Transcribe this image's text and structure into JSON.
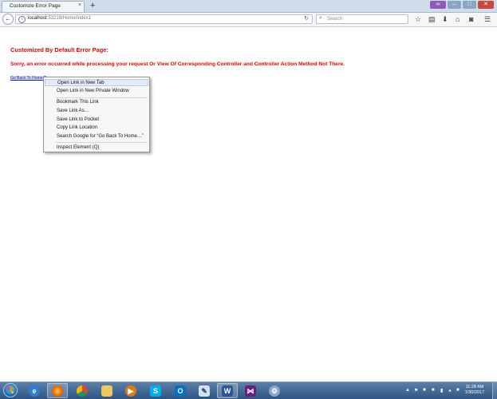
{
  "browser": {
    "tab_title": "Customize Error Page",
    "tab_close": "×",
    "new_tab": "+",
    "url_host": "localhost",
    "url_rest": ":53218/Home/index1",
    "search_placeholder": "Search"
  },
  "page": {
    "title": "Customized By Default Error Page:",
    "message": "Sorry, an error occurred while processing your request Or View Of Corresponding Controller and Controller Action Method Not There.",
    "home_link": "Go Back To Home P"
  },
  "context_menu": {
    "items": [
      "Open Link in New Tab",
      "Open Link in New Private Window",
      "Bookmark This Link",
      "Save Link As…",
      "Save Link to Pocket",
      "Copy Link Location",
      "Search Google for “Go Back To Home…”",
      "Inspect Element (Q)"
    ]
  },
  "taskbar": {
    "apps": [
      "internet-explorer-icon",
      "firefox-icon",
      "chrome-icon",
      "file-explorer-icon",
      "media-player-icon",
      "skype-icon",
      "outlook-icon",
      "paint-icon",
      "word-icon",
      "visual-studio-icon",
      "network-icon"
    ],
    "time": "11:28 AM",
    "date": "1/30/2017"
  },
  "colors": {
    "error_red": "#ee0000",
    "link_blue": "#1a0dab",
    "taskbar": "#2f5583"
  }
}
